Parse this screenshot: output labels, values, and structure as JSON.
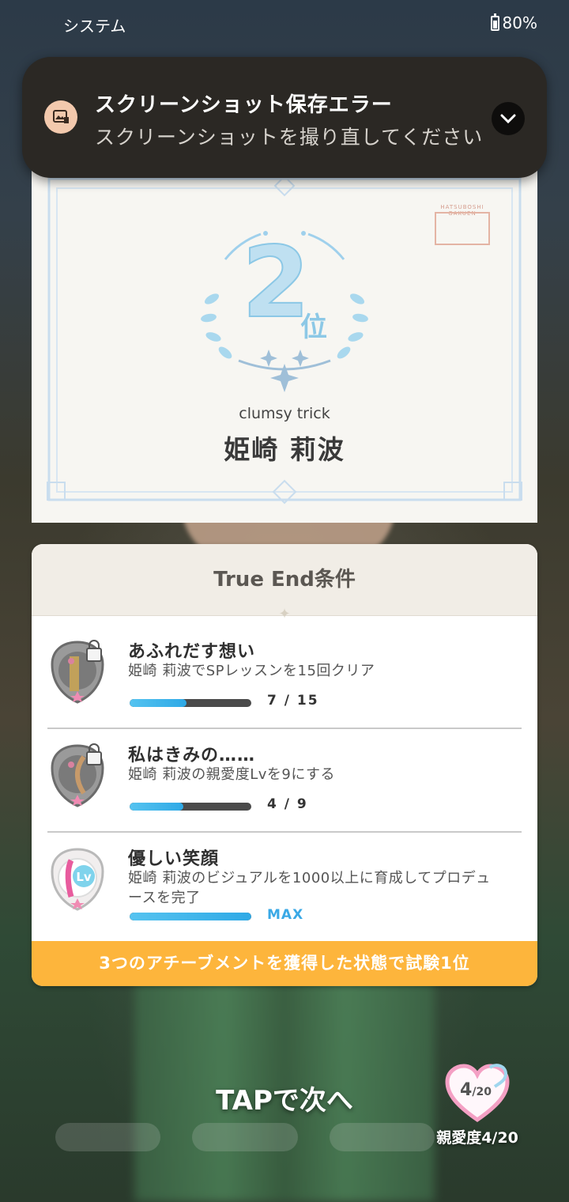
{
  "status_bar": {
    "app_name": "システム",
    "battery": "80%"
  },
  "notification": {
    "title": "スクリーンショット保存エラー",
    "text": "スクリーンショットを撮り直してください"
  },
  "certificate": {
    "rank_number": "2",
    "rank_suffix": "位",
    "stamp_text": "HATSUBOSHI GAKUEN",
    "name_en": "clumsy trick",
    "name_jp": "姫崎 莉波"
  },
  "true_end": {
    "title": "True End条件",
    "achievements": [
      {
        "title": "あふれだす想い",
        "desc": "姫崎 莉波でSPレッスンを15回クリア",
        "progress_text": "7 / 15",
        "progress": 0.47,
        "locked": true
      },
      {
        "title": "私はきみの……",
        "desc": "姫崎 莉波の親愛度Lvを9にする",
        "progress_text": "4 / 9",
        "progress": 0.44,
        "locked": true
      },
      {
        "title": "優しい笑顔",
        "desc": "姫崎 莉波のビジュアルを1000以上に育成してプロデュースを完了",
        "progress_text": "MAX",
        "progress": 1.0,
        "locked": false
      }
    ],
    "footer": "3つのアチーブメントを獲得した状態で試験1位"
  },
  "tap_next": "TAPで次へ",
  "affinity": {
    "value": "4",
    "max": "20",
    "label": "親愛度4/20"
  },
  "colors": {
    "accent_blue": "#2ea9e6",
    "footer_orange": "#fdb53c",
    "notification_bg": "#2b2824"
  }
}
